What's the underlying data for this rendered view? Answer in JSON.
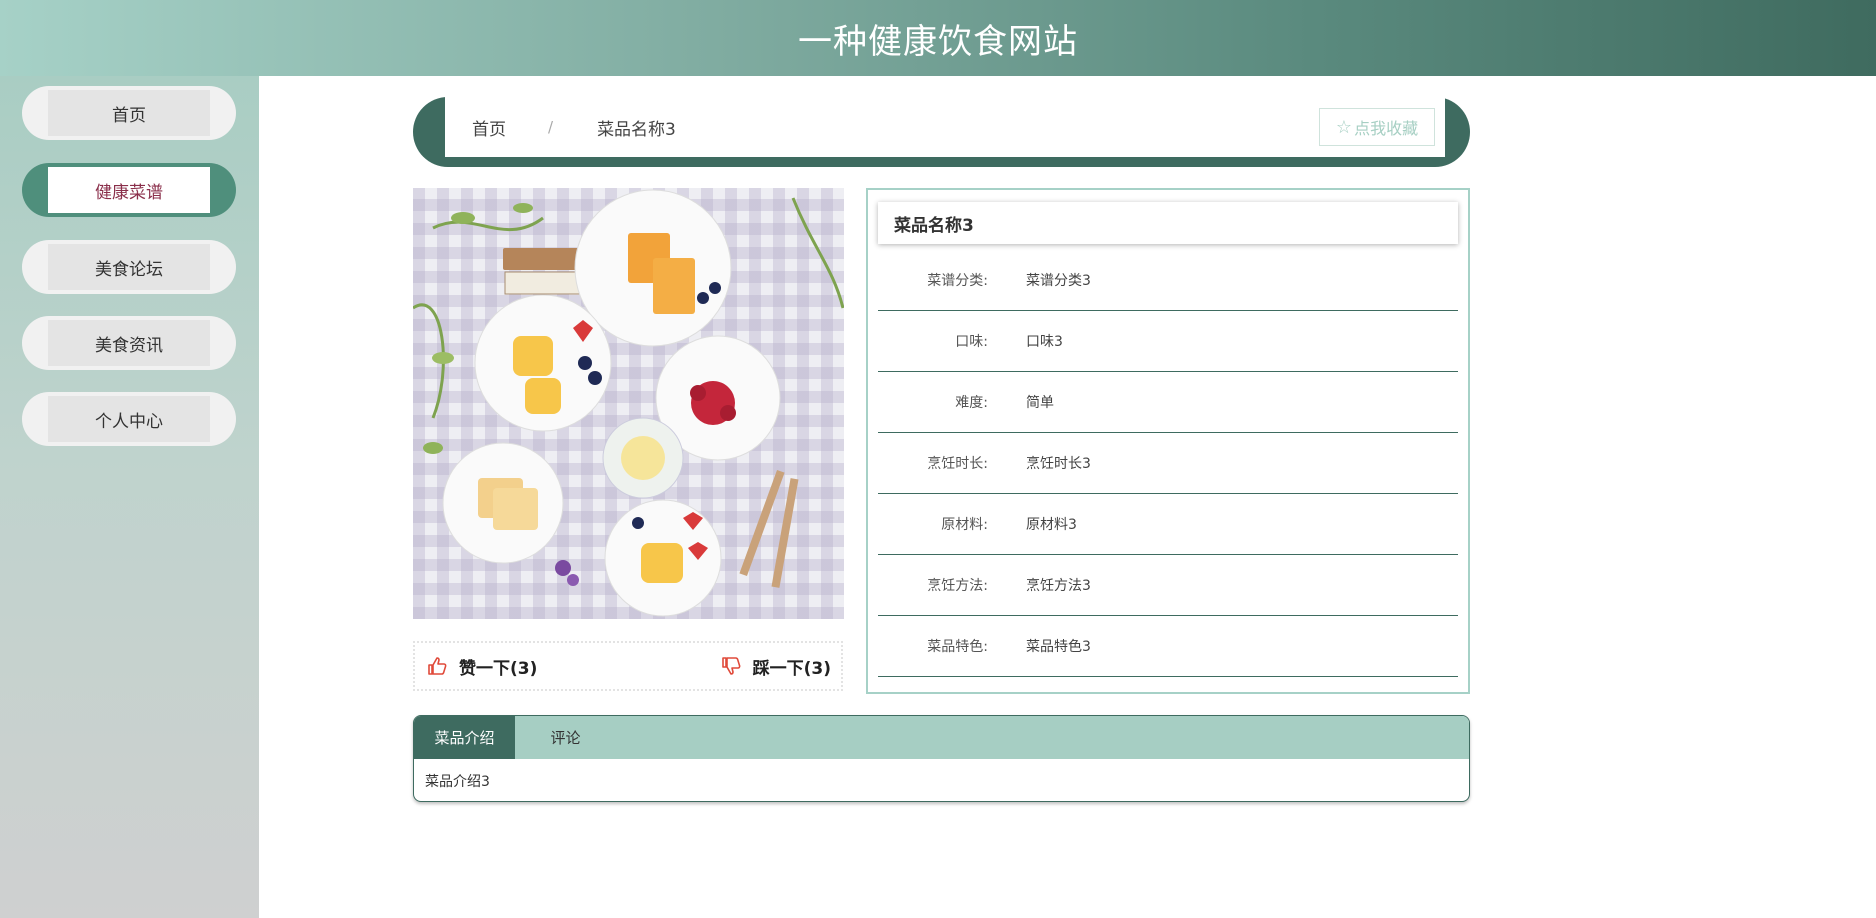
{
  "header": {
    "title": "一种健康饮食网站"
  },
  "sidebar": {
    "items": [
      {
        "label": "首页",
        "active": false
      },
      {
        "label": "健康菜谱",
        "active": true
      },
      {
        "label": "美食论坛",
        "active": false
      },
      {
        "label": "美食资讯",
        "active": false
      },
      {
        "label": "个人中心",
        "active": false
      }
    ]
  },
  "breadcrumb": {
    "home": "首页",
    "separator": "/",
    "current": "菜品名称3",
    "favorite_label": "点我收藏",
    "favorite_icon": "star-outline-icon"
  },
  "votes": {
    "up_label": "赞一下(3)",
    "down_label": "踩一下(3)"
  },
  "detail": {
    "title": "菜品名称3",
    "rows": [
      {
        "label": "菜谱分类:",
        "value": "菜谱分类3"
      },
      {
        "label": "口味:",
        "value": "口味3"
      },
      {
        "label": "难度:",
        "value": "简单"
      },
      {
        "label": "烹饪时长:",
        "value": "烹饪时长3"
      },
      {
        "label": "原材料:",
        "value": "原材料3"
      },
      {
        "label": "烹饪方法:",
        "value": "烹饪方法3"
      },
      {
        "label": "菜品特色:",
        "value": "菜品特色3"
      }
    ]
  },
  "tabs": {
    "items": [
      {
        "label": "菜品介绍",
        "active": true
      },
      {
        "label": "评论",
        "active": false
      }
    ],
    "content": "菜品介绍3"
  },
  "colors": {
    "accent_dark": "#3e6b60",
    "accent_light": "#a6d1c7",
    "active_nav_text": "#8a2e4a",
    "vote_icon": "#e04a3a"
  }
}
